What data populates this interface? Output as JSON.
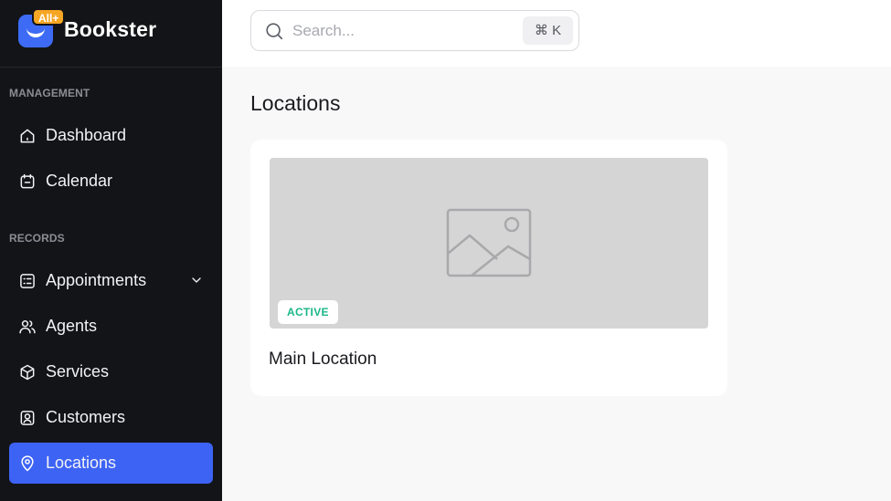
{
  "app": {
    "name": "Bookster",
    "badge": "All+"
  },
  "sidebar": {
    "sections": [
      {
        "label": "MANAGEMENT"
      },
      {
        "label": "RECORDS"
      }
    ],
    "items": [
      {
        "label": "Dashboard",
        "icon": "home-icon"
      },
      {
        "label": "Calendar",
        "icon": "calendar-icon"
      },
      {
        "label": "Appointments",
        "icon": "checklist-icon"
      },
      {
        "label": "Agents",
        "icon": "users-icon"
      },
      {
        "label": "Services",
        "icon": "box-icon"
      },
      {
        "label": "Customers",
        "icon": "user-square-icon"
      },
      {
        "label": "Locations",
        "icon": "map-pin-icon",
        "active": true
      }
    ]
  },
  "search": {
    "placeholder": "Search...",
    "shortcut": "⌘ K"
  },
  "main": {
    "title": "Locations",
    "cards": [
      {
        "title": "Main Location",
        "status": "ACTIVE"
      }
    ]
  },
  "colors": {
    "sidebar_bg": "#131418",
    "accent": "#3d63f5",
    "badge": "#f6a623",
    "status_active": "#1bb68a"
  }
}
